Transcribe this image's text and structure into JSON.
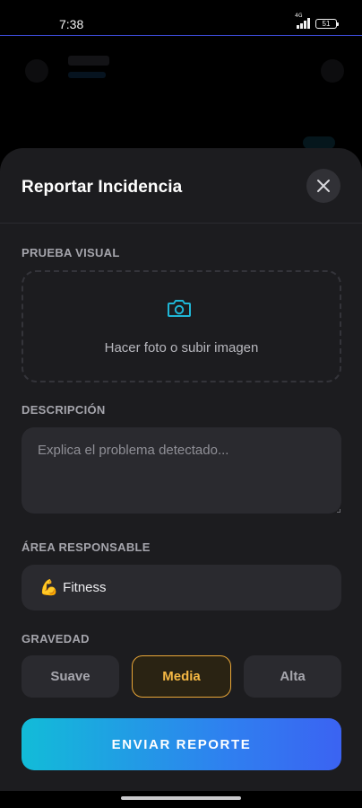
{
  "status_bar": {
    "time": "7:38",
    "network": "4G",
    "battery": "51"
  },
  "sheet": {
    "title": "Reportar Incidencia",
    "close_icon": "close-icon",
    "visual_proof": {
      "label": "PRUEBA VISUAL",
      "icon": "camera-icon",
      "upload_text": "Hacer foto o subir imagen"
    },
    "description": {
      "label": "DESCRIPCIÓN",
      "placeholder": "Explica el problema detectado..."
    },
    "responsible_area": {
      "label": "ÁREA RESPONSABLE",
      "emoji": "💪",
      "selected": "Fitness"
    },
    "severity": {
      "label": "GRAVEDAD",
      "options": [
        "Suave",
        "Media",
        "Alta"
      ],
      "selected": "Media"
    },
    "submit_label": "ENVIAR REPORTE"
  },
  "colors": {
    "accent_gradient_start": "#12bcd8",
    "accent_gradient_end": "#3b63f2",
    "severity_active": "#e8a638",
    "sheet_bg": "#1c1c1f"
  }
}
